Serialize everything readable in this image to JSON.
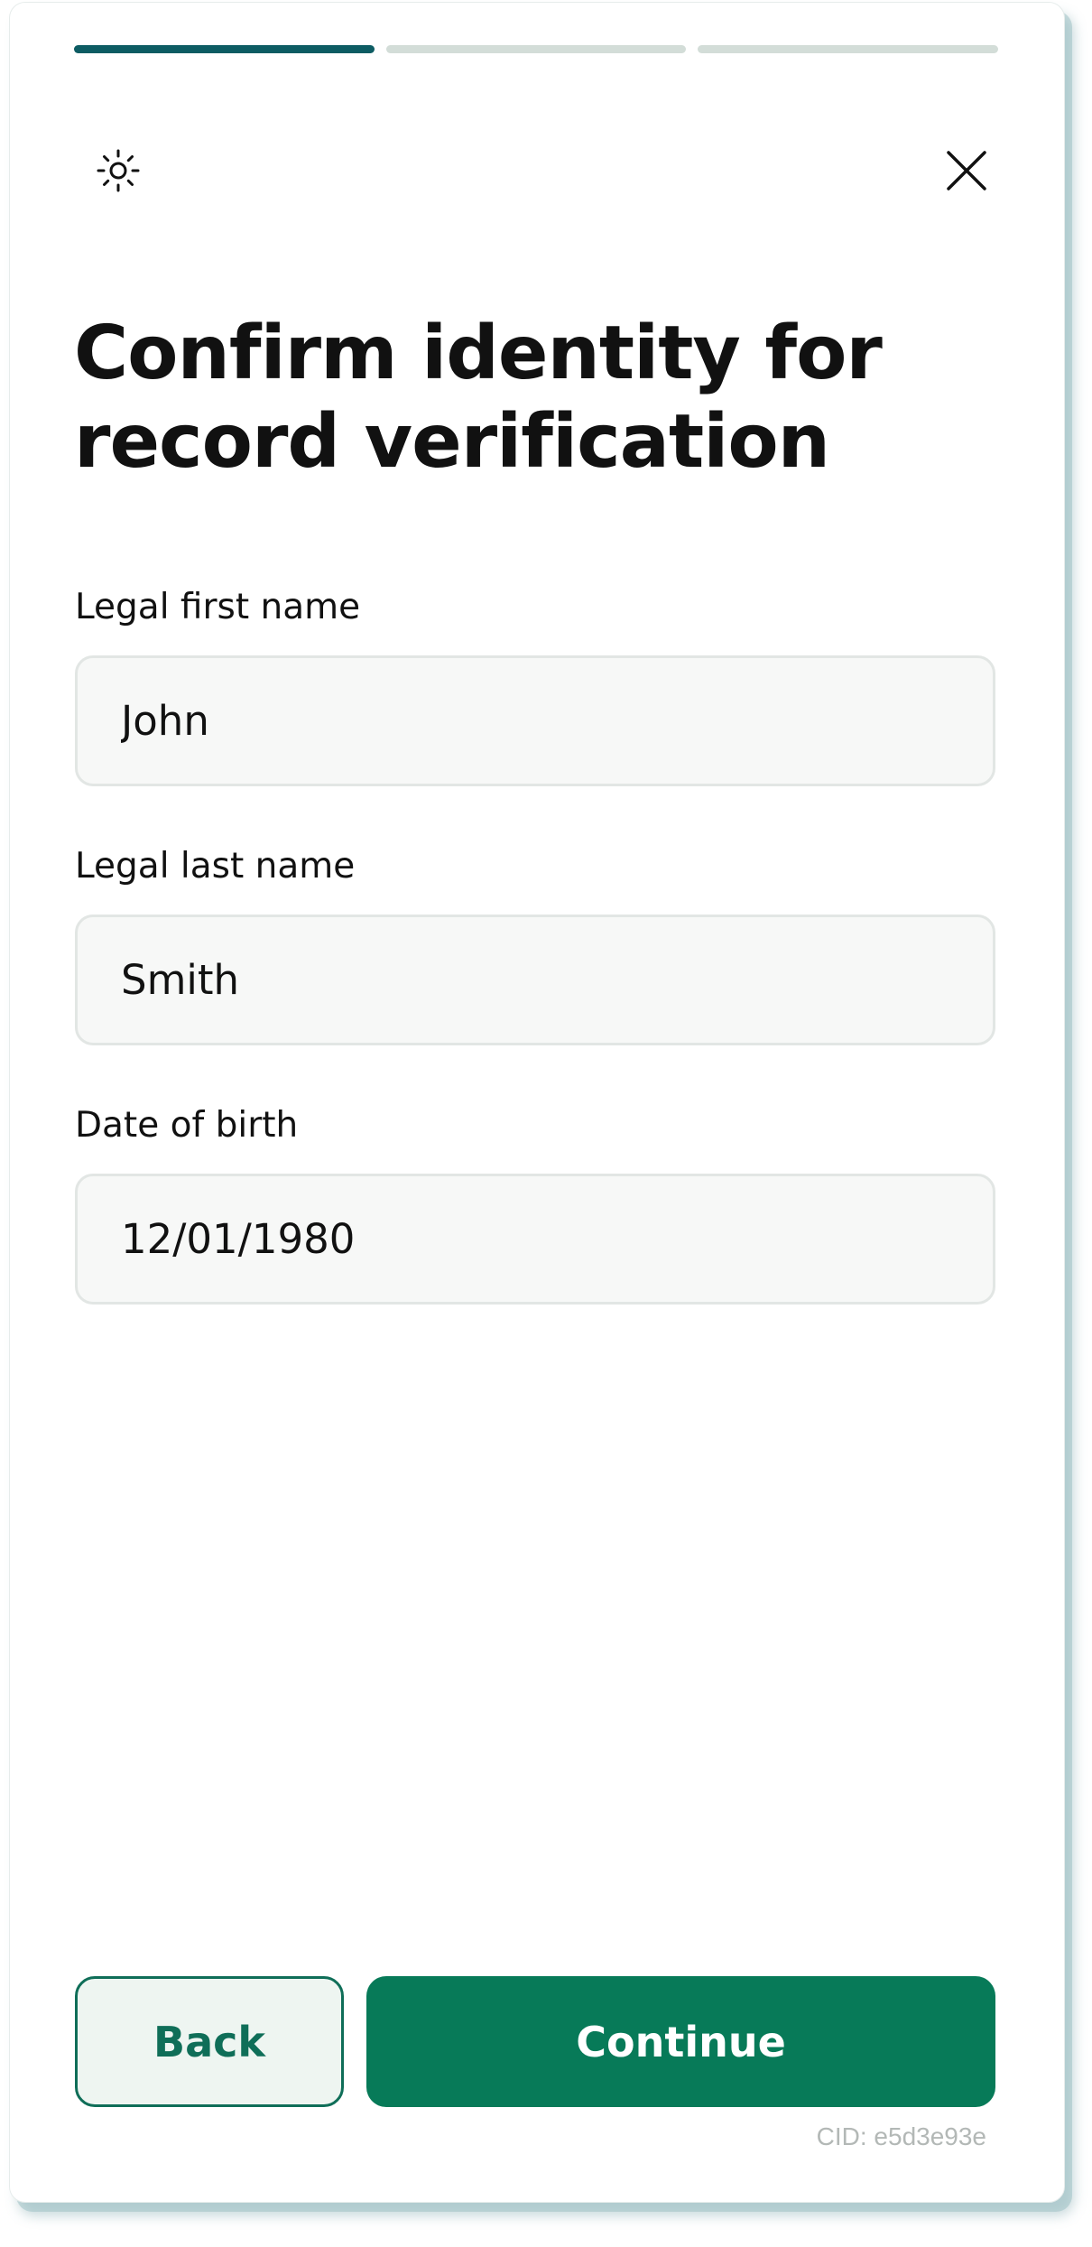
{
  "progress": {
    "steps_total": 3,
    "current_step": 1
  },
  "icons": {
    "theme": "sun-icon",
    "close": "close-icon"
  },
  "page": {
    "title_line1": "Confirm identity for",
    "title_line2": "record verification"
  },
  "form": {
    "first_name": {
      "label": "Legal first name",
      "value": "John"
    },
    "last_name": {
      "label": "Legal last name",
      "value": "Smith"
    },
    "dob": {
      "label": "Date of birth",
      "value": "12/01/1980"
    }
  },
  "actions": {
    "back_label": "Back",
    "continue_label": "Continue"
  },
  "footer": {
    "cid": "CID: e5d3e93e"
  },
  "colors": {
    "progress_active": "#0d5c63",
    "progress_inactive": "#d3ddd8",
    "primary": "#077a58",
    "back_border": "#0f6e58",
    "back_bg": "#eef5f1"
  }
}
